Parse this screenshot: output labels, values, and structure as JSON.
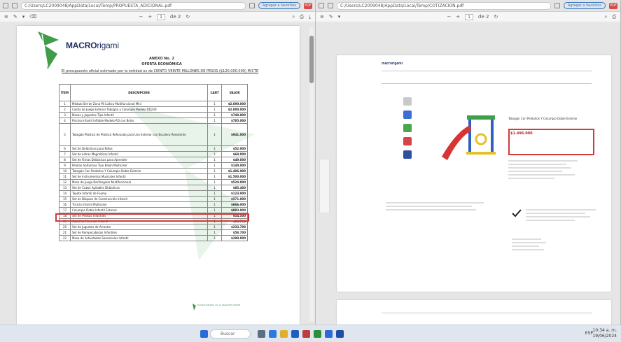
{
  "left_window": {
    "url": "C:/Users/LC2009048/AppData/Local/Temp/PROPUESTA_ADICIONAL.pdf",
    "pill": "Agregar a favoritos",
    "toolbar": {
      "nav": "≡",
      "page_input": "1",
      "of": "de 2",
      "zoom": "112"
    }
  },
  "right_window": {
    "url": "C:/Users/LC2009048/AppData/Local/Temp/COTIZACION.pdf",
    "pill": "Agregar a favoritos",
    "toolbar": {
      "page_input": "1",
      "of": "de 2",
      "zoom": "112"
    }
  },
  "document": {
    "brand_strong": "MACRO",
    "brand_soft": "rigami",
    "heading1": "ANEXO No. 2",
    "heading2": "OFERTA ECONÓMICA",
    "intro": "El presupuesto oficial estimado por la entidad es de CIENTO VEINTE MILLONES DE PESOS ($120.000.000) M/CTE",
    "table": {
      "headers": [
        "ÍTEM",
        "DESCRIPCIÓN",
        "CANT",
        "VALOR"
      ],
      "rows": [
        {
          "n": "1",
          "desc": "Módulo Set de Zona Mi Lúdica Multifuncional Mini",
          "u": "1",
          "v": "$2.690.000"
        },
        {
          "n": "2",
          "desc": "Casita de Juego Exterior Tobogán y Columpio Modelo RD230",
          "u": "1",
          "v": "$2.000.000"
        },
        {
          "n": "3",
          "desc": "Mesas y Juguetes Tipo Infantil",
          "u": "1",
          "v": "$749.000"
        },
        {
          "n": "4",
          "desc": "Piscina Infantil Inflable Modelo RD con Bolas",
          "u": "1",
          "v": "$785.000"
        },
        {
          "n": "5",
          "desc": "Tobogán Plástico de Plástico Reforzado para Uso Exterior con Escalera Resistente",
          "u": "1",
          "v": "$941.000"
        },
        {
          "n": "6",
          "desc": "Set de Didácticos para Niños",
          "u": "1",
          "v": "$52.000"
        },
        {
          "n": "7",
          "desc": "Set de Letras Magnéticas Infantil",
          "u": "1",
          "v": "$69.000"
        },
        {
          "n": "8",
          "desc": "Set de Fichas Didácticas para Aprender",
          "u": "1",
          "v": "$49.000"
        },
        {
          "n": "9",
          "desc": "Pelotas Saltarinas Tipo Balón Multicolor",
          "u": "1",
          "v": "$140.000"
        },
        {
          "n": "10",
          "desc": "Tobogán Con Peldaños Y Columpio Doble Exterior",
          "u": "1",
          "v": "$1.496.000"
        },
        {
          "n": "11",
          "desc": "Set de Instrumentos Musicales Infantil",
          "u": "1",
          "v": "$1.500.000"
        },
        {
          "n": "12",
          "desc": "Mesa de Juego Rectangular Multifuncional",
          "u": "1",
          "v": "$524.000"
        },
        {
          "n": "13",
          "desc": "Set de Cubos Apilables Didácticos",
          "u": "1",
          "v": "$85.400"
        },
        {
          "n": "14",
          "desc": "Tapete Infantil de Foamy",
          "u": "1",
          "v": "$123.000"
        },
        {
          "n": "15",
          "desc": "Set de Bloques de Construcción Infantil",
          "u": "1",
          "v": "$571.000"
        },
        {
          "n": "16",
          "desc": "Triciclo Infantil Multicolor",
          "u": "1",
          "v": "$666.000"
        },
        {
          "n": "17",
          "desc": "Columpio Doble Infantil Exterior",
          "u": "1",
          "v": "$983.000"
        },
        {
          "n": "18",
          "desc": "Set de Pelotas Infantiles",
          "u": "1",
          "v": "$54.500"
        },
        {
          "n": "19",
          "desc": "Caballito Mecedor Infantil",
          "u": "1",
          "v": "$86.700"
        },
        {
          "n": "20",
          "desc": "Set de Juguetes de Arrastre",
          "u": "1",
          "v": "$233.700"
        },
        {
          "n": "21",
          "desc": "Set de Rompecabezas Infantiles",
          "u": "1",
          "v": "$58.700"
        },
        {
          "n": "22",
          "desc": "Mesa de Actividades Sensoriales Infantil",
          "u": "1",
          "v": "$290.000"
        }
      ]
    },
    "footer": "Comprometidos con el desarrollo infantil"
  },
  "web_capture": {
    "logo": "macrorigami",
    "product_title": "Tobogán Con Peldaños Y Columpio Doble Exterior",
    "price": "$1.496.000"
  },
  "taskbar": {
    "search": "Buscar",
    "tray": "ESP",
    "time": "10:34 a. m.",
    "date": "19/06/2024"
  },
  "colors": {
    "highlight": "#d13a3a",
    "brand": "#1d2d5e",
    "leaf": "#3f9d4a"
  }
}
